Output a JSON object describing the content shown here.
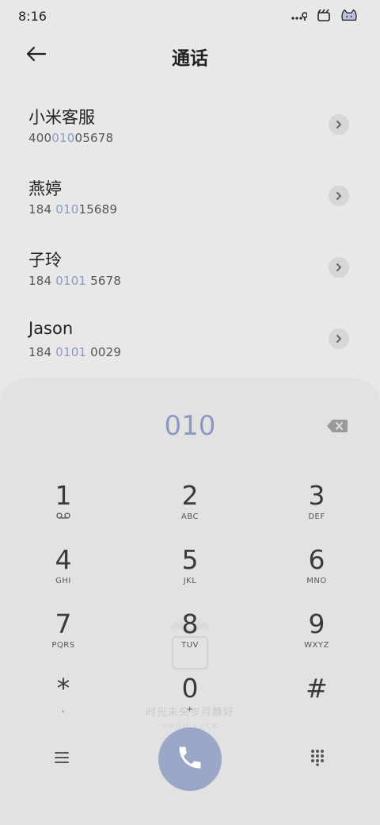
{
  "status_bar": {
    "time": "8:16",
    "icons": [
      "dots-icon",
      "location-icon",
      "clapper-icon",
      "cat-icon"
    ]
  },
  "header": {
    "title": "通话",
    "back_icon": "arrow-left-icon"
  },
  "contacts": [
    {
      "name": "小米客服",
      "number_pre": "400",
      "number_hl": "010",
      "number_post": "05678"
    },
    {
      "name": "燕婷",
      "number_pre": "184 ",
      "number_hl": "010",
      "number_post": "15689"
    },
    {
      "name": "子玲",
      "number_pre": "184 ",
      "number_hl": "0101",
      "number_post": " 5678"
    },
    {
      "name": "Jason",
      "number_pre": "184 ",
      "number_hl": "0101",
      "number_post": " 0029"
    }
  ],
  "dialer": {
    "input": "010",
    "keys": [
      {
        "digit": "1",
        "letters": ""
      },
      {
        "digit": "2",
        "letters": "ABC"
      },
      {
        "digit": "3",
        "letters": "DEF"
      },
      {
        "digit": "4",
        "letters": "GHI"
      },
      {
        "digit": "5",
        "letters": "JKL"
      },
      {
        "digit": "6",
        "letters": "MNO"
      },
      {
        "digit": "7",
        "letters": "PQRS"
      },
      {
        "digit": "8",
        "letters": "TUV"
      },
      {
        "digit": "9",
        "letters": "WXYZ"
      },
      {
        "digit": "*",
        "letters": ","
      },
      {
        "digit": "0",
        "letters": "+"
      },
      {
        "digit": "#",
        "letters": ""
      }
    ],
    "watermark_text": "时光未央岁月静好",
    "watermark_subtext": "GOOD LUCK"
  },
  "colors": {
    "accent": "#8a9ac0",
    "call_button": "#9ba7c6",
    "background": "#e8e8e8",
    "dialer_background": "#e2e2e2"
  }
}
